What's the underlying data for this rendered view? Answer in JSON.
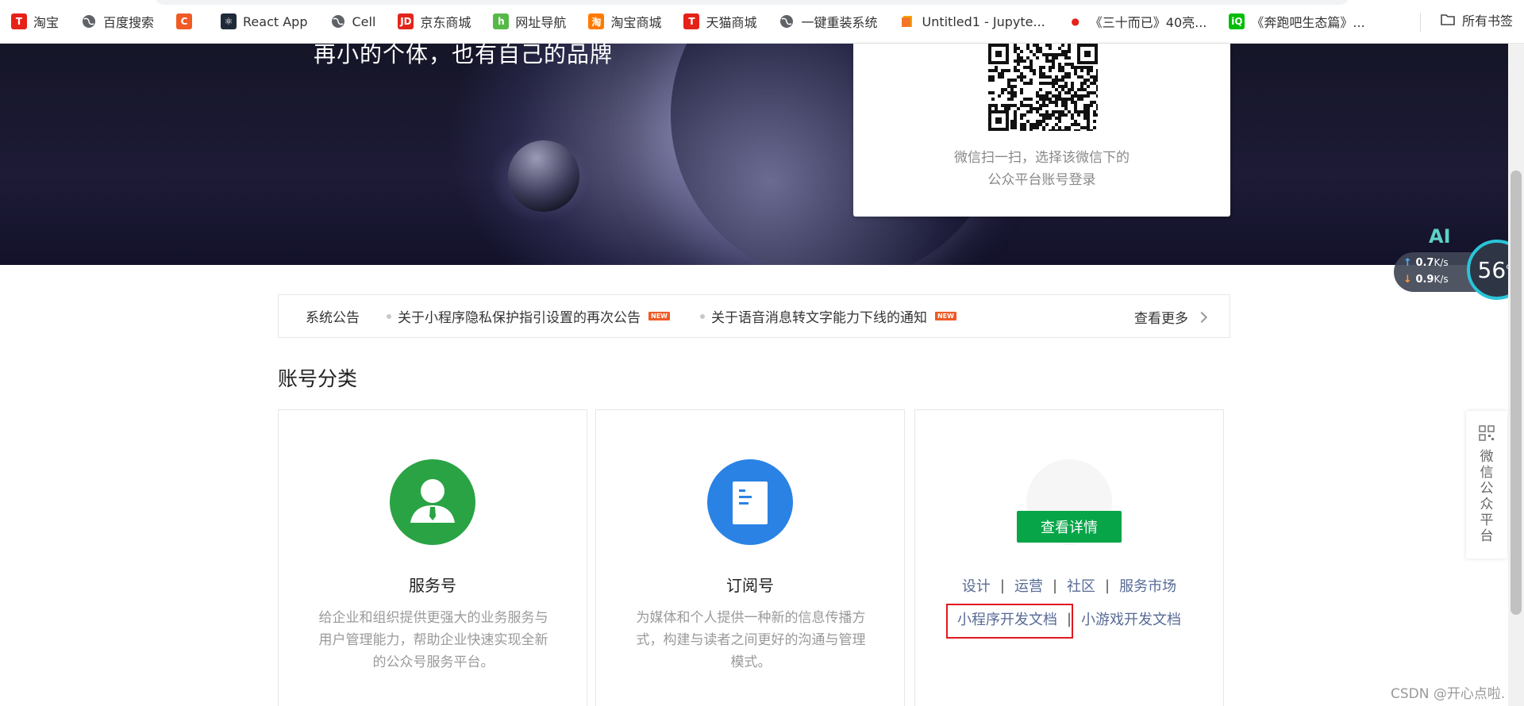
{
  "bookmarks": {
    "items": [
      {
        "label": "淘宝",
        "icon": "taobao-icon",
        "color": "#e62117",
        "glyph": "T"
      },
      {
        "label": "百度搜索",
        "icon": "globe-icon",
        "color": "#5f6368",
        "glyph": ""
      },
      {
        "label": "",
        "icon": "c-app-icon",
        "color": "#f05a24",
        "glyph": "C"
      },
      {
        "label": "React App",
        "icon": "react-icon",
        "color": "#1f2a3a",
        "glyph": "⚛"
      },
      {
        "label": "Cell",
        "icon": "globe-icon",
        "color": "#5f6368",
        "glyph": ""
      },
      {
        "label": "京东商城",
        "icon": "jd-icon",
        "color": "#e1251b",
        "glyph": "JD"
      },
      {
        "label": "网址导航",
        "icon": "hao-icon",
        "color": "#56b947",
        "glyph": "h"
      },
      {
        "label": "淘宝商城",
        "icon": "taobao-mall-icon",
        "color": "#ff7a00",
        "glyph": "淘"
      },
      {
        "label": "天猫商城",
        "icon": "tmall-icon",
        "color": "#e62117",
        "glyph": "T"
      },
      {
        "label": "一键重装系统",
        "icon": "globe-icon",
        "color": "#5f6368",
        "glyph": ""
      },
      {
        "label": "Untitled1 - Jupyte...",
        "icon": "jupyter-icon",
        "color": "#f37626",
        "glyph": ""
      },
      {
        "label": "《三十而已》40亮...",
        "icon": "video-icon",
        "color": "#e62117",
        "glyph": "●"
      },
      {
        "label": "《奔跑吧生态篇》...",
        "icon": "iqiyi-icon",
        "color": "#00be06",
        "glyph": "iQ"
      }
    ],
    "all_bookmarks": "所有书签"
  },
  "banner": {
    "slogan": "再小的个体，也有自己的品牌",
    "qr_tip_line1": "微信扫一扫，选择该微信下的",
    "qr_tip_line2": "公众平台账号登录"
  },
  "notice": {
    "title": "系统公告",
    "items": [
      {
        "text": "关于小程序隐私保护指引设置的再次公告",
        "badge": "NEW"
      },
      {
        "text": "关于语音消息转文字能力下线的通知",
        "badge": "NEW"
      }
    ],
    "more": "查看更多"
  },
  "section_title": "账号分类",
  "cards": [
    {
      "name": "服务号",
      "desc": "给企业和组织提供更强大的业务服务与用户管理能力，帮助企业快速实现全新的公众号服务平台。",
      "color": "#2aa344"
    },
    {
      "name": "订阅号",
      "desc": "为媒体和个人提供一种新的信息传播方式，构建与读者之间更好的沟通与管理模式。",
      "color": "#2a82e4"
    }
  ],
  "mini_card": {
    "detail_button": "查看详情",
    "links_row1": [
      "设计",
      "运营",
      "社区",
      "服务市场"
    ],
    "links_row2": [
      "小程序开发文档",
      "小游戏开发文档"
    ]
  },
  "speed_widget": {
    "upload": "0.7",
    "download": "0.9",
    "unit": "K/s",
    "percent": "56",
    "percent_sign": "%",
    "ai": "AI"
  },
  "side_float": {
    "label": "微信公众平台"
  },
  "watermark": "CSDN @开心点啦."
}
